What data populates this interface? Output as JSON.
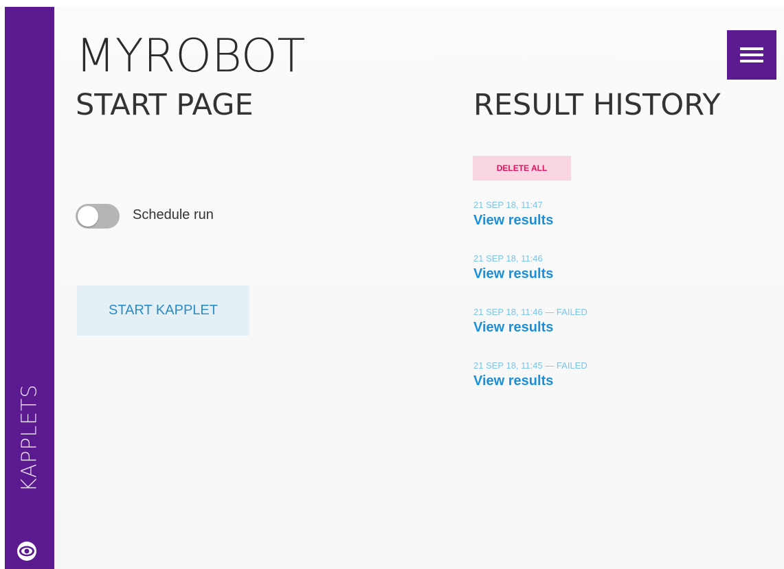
{
  "sidebar": {
    "label": "KAPPLETS",
    "logo_icon": "eye-logo-icon",
    "bg_color": "#5c1a91"
  },
  "header": {
    "app_title": "MYROBOT",
    "page_title": "START PAGE",
    "menu_icon": "hamburger-menu-icon"
  },
  "schedule": {
    "label": "Schedule run",
    "enabled": false
  },
  "start_button": {
    "label": "START KAPPLET"
  },
  "history": {
    "title": "RESULT HISTORY",
    "delete_all_label": "DELETE ALL",
    "items": [
      {
        "timestamp": "21 SEP 18, 11:47",
        "link": "View results"
      },
      {
        "timestamp": "21 SEP 18, 11:46",
        "link": "View results"
      },
      {
        "timestamp": "21 SEP 18, 11:46 — FAILED",
        "link": "View results"
      },
      {
        "timestamp": "21 SEP 18, 11:45 — FAILED",
        "link": "View results"
      }
    ]
  },
  "colors": {
    "accent": "#5c1a91",
    "link": "#1b8fd8",
    "danger": "#e3145f"
  }
}
